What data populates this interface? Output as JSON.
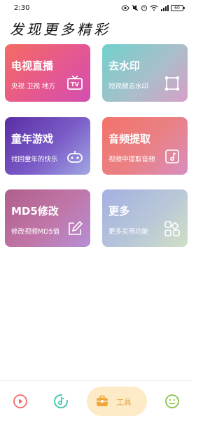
{
  "status_bar": {
    "time": "2:30",
    "battery": "60",
    "signal_label": "4G"
  },
  "page_title": "发现更多精彩",
  "cards": {
    "live": {
      "title": "电视直播",
      "subtitle": "央视 卫视 地方",
      "icon": "tv-icon"
    },
    "watermark": {
      "title": "去水印",
      "subtitle": "短视频去水印",
      "icon": "crop-frame-icon"
    },
    "games": {
      "title": "童年游戏",
      "subtitle": "找回童年的快乐",
      "icon": "gamepad-icon"
    },
    "audio": {
      "title": "音频提取",
      "subtitle": "视频中提取音频",
      "icon": "music-note-icon"
    },
    "md5": {
      "title": "MD5修改",
      "subtitle": "修改视频MD5值",
      "icon": "edit-icon"
    },
    "more": {
      "title": "更多",
      "subtitle": "更多实用功能",
      "icon": "grid-icon"
    }
  },
  "bottom_nav": {
    "tools_label": "工具",
    "active": "tools",
    "colors": {
      "video": "#f26b6b",
      "music": "#3cc3a8",
      "tools": "#f0a73a",
      "face": "#8bc34a",
      "tools_bg": "#fdebc7"
    }
  }
}
